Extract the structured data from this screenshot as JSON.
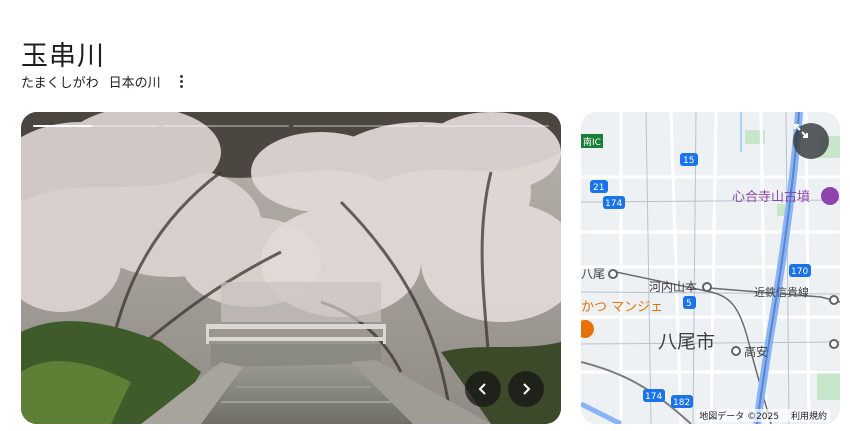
{
  "header": {
    "title": "玉串川",
    "reading": "たまくしがわ",
    "category": "日本の川"
  },
  "gallery": {
    "segments": [
      1,
      0,
      0,
      0
    ],
    "progress": 0.47
  },
  "map": {
    "labels": {
      "ic": "南IC",
      "kofun": "心合寺山古墳",
      "yao_station": "八尾",
      "kawachi_yamamoto": "河内山本",
      "kintetsu_line": "近鉄信貴線",
      "restaurant": "かつ マンジェ",
      "yao_city": "八尾市",
      "takayasu": "高安"
    },
    "routes": [
      "15",
      "21",
      "174",
      "170",
      "5",
      "174",
      "182"
    ],
    "attribution_data": "地図データ ©2025",
    "attribution_terms": "利用規約"
  },
  "colors": {
    "route_badge": "#1a73e8",
    "poi_purple": "#8e44ad",
    "poi_orange": "#e8710a",
    "highway": "#8ab4f8"
  }
}
